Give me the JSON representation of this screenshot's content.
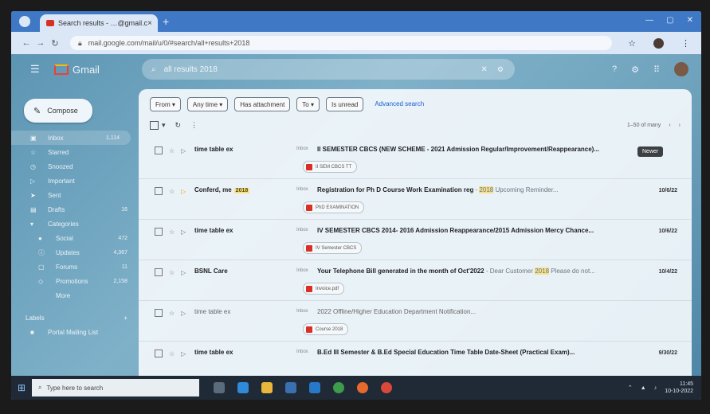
{
  "browser": {
    "tab_title": "Search results - …@gmail.com",
    "url": "mail.google.com/mail/u/0/#search/all+results+2018",
    "new_tab": "+",
    "tab_close": "×"
  },
  "gmail": {
    "logo_text": "Gmail",
    "search_query": "all results 2018",
    "compose_label": "Compose"
  },
  "sidebar": {
    "items": [
      {
        "label": "Inbox",
        "count": "1,114",
        "icon": "inbox-icon",
        "glyph": "▣"
      },
      {
        "label": "Starred",
        "count": "",
        "icon": "star-icon",
        "glyph": "☆"
      },
      {
        "label": "Snoozed",
        "count": "",
        "icon": "clock-icon",
        "glyph": "◷"
      },
      {
        "label": "Important",
        "count": "",
        "icon": "important-icon",
        "glyph": "▷"
      },
      {
        "label": "Sent",
        "count": "",
        "icon": "send-icon",
        "glyph": "➤"
      },
      {
        "label": "Drafts",
        "count": "16",
        "icon": "draft-icon",
        "glyph": "▤"
      },
      {
        "label": "Categories",
        "count": "",
        "icon": "label-icon",
        "glyph": "▾"
      },
      {
        "label": "Social",
        "count": "472",
        "icon": "people-icon",
        "glyph": "●",
        "sub": true
      },
      {
        "label": "Updates",
        "count": "4,367",
        "icon": "info-icon",
        "glyph": "ⓘ",
        "sub": true
      },
      {
        "label": "Forums",
        "count": "11",
        "icon": "forum-icon",
        "glyph": "▢",
        "sub": true
      },
      {
        "label": "Promotions",
        "count": "2,158",
        "icon": "tag-icon",
        "glyph": "◇",
        "sub": true
      },
      {
        "label": "More",
        "count": "",
        "icon": "chevron-down-icon",
        "glyph": "",
        "sub": true
      }
    ],
    "labels_heading": "Labels",
    "labels_plus": "+",
    "label_items": [
      {
        "label": "Portal Mailing List",
        "count": "",
        "icon": "label-icon",
        "glyph": "■"
      }
    ]
  },
  "filters": {
    "chips": [
      "From ▾",
      "Any time ▾",
      "Has attachment",
      "To ▾",
      "Is unread"
    ],
    "advanced": "Advanced search"
  },
  "list": {
    "pager": "1–50 of many",
    "tooltip": "Newer"
  },
  "emails": [
    {
      "sender": "time table ex",
      "tag": "",
      "inbox": "Inbox",
      "subject": "II SEMESTER CBCS (NEW SCHEME - 2021 Admission Regular/Improvement/Reappearance)...",
      "snippet": "",
      "highlight": "",
      "attachment": "II SEM CBCS TT",
      "date": "",
      "read": false
    },
    {
      "sender": "Conferd, me",
      "tag": "2018",
      "inbox": "Inbox",
      "subject": "Registration for Ph D Course Work Examination reg",
      "snippet": " - ",
      "highlight": "2018",
      "snippet2": " Upcoming Reminder...",
      "attachment": "PhD EXAMINATION",
      "date": "10/6/22",
      "read": false
    },
    {
      "sender": "time table ex",
      "tag": "",
      "inbox": "Inbox",
      "subject": "IV SEMESTER CBCS 2014- 2016 Admission Reappearance/2015 Admission Mercy Chance...",
      "snippet": "",
      "highlight": "",
      "attachment": "IV Semester CBCS",
      "date": "10/6/22",
      "read": false
    },
    {
      "sender": "BSNL Care",
      "tag": "",
      "inbox": "Inbox",
      "subject": "Your Telephone Bill generated in the month of Oct'2022",
      "snippet": " - Dear Customer ",
      "highlight": "2018",
      "snippet2": " Please do not...",
      "attachment": "Invoice.pdf",
      "date": "10/4/22",
      "read": false
    },
    {
      "sender": "time table ex",
      "tag": "",
      "inbox": "Inbox",
      "subject": "2022 Offline/Higher Education Department Notification...",
      "snippet": "",
      "highlight": "",
      "attachment": "Course 2018",
      "date": "",
      "read": true
    },
    {
      "sender": "time table ex",
      "tag": "",
      "inbox": "Inbox",
      "subject": "B.Ed III Semester & B.Ed Special Education Time Table Date-Sheet (Practical Exam)...",
      "snippet": "",
      "highlight": "",
      "attachment": "",
      "date": "9/30/22",
      "read": false
    }
  ],
  "taskbar": {
    "search_placeholder": "Type here to search",
    "time": "11:45",
    "date": "10-10-2022"
  },
  "colors": {
    "gmail_red": "#d93025",
    "accent_blue": "#1a5fd1",
    "highlight": "#f6e08e"
  }
}
